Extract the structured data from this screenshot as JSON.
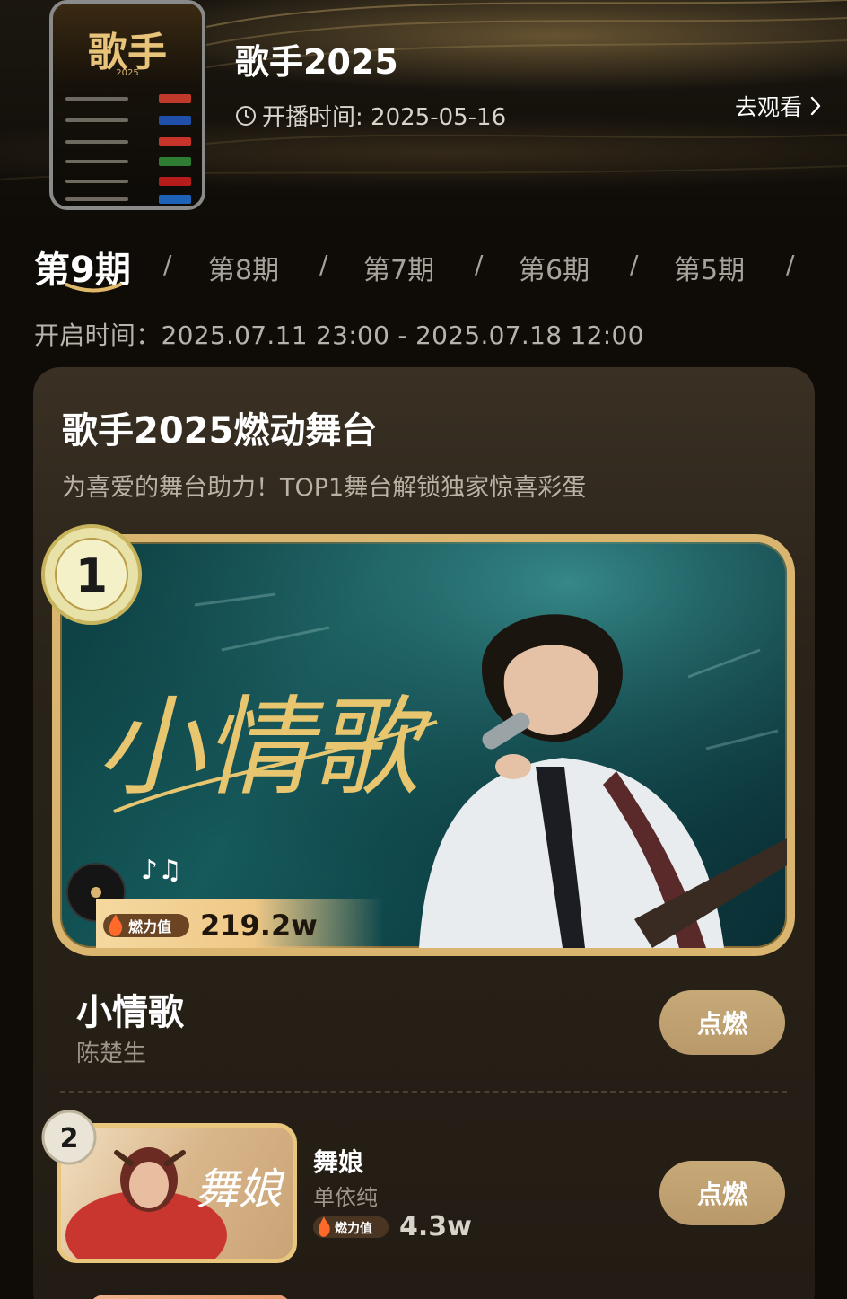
{
  "header": {
    "show_title": "歌手2025",
    "air_label": "开播时间: 2025-05-16",
    "watch_label": "去观看",
    "poster_title": "歌手",
    "poster_year": "2025"
  },
  "episodes": {
    "tabs": [
      "第9期",
      "第8期",
      "第7期",
      "第6期",
      "第5期"
    ],
    "separator": "/",
    "active_index": 0
  },
  "open_time": "开启时间：2025.07.11 23:00 - 2025.07.18 12:00",
  "board": {
    "title": "歌手2025燃动舞台",
    "subtitle": "为喜爱的舞台助力！TOP1舞台解锁独家惊喜彩蛋",
    "fire_label": "燃力值",
    "ignite_label": "点燃",
    "entries": [
      {
        "rank": "1",
        "art_text": "小情歌",
        "song": "小情歌",
        "artist": "陈楚生",
        "fire_value": "219.2w"
      },
      {
        "rank": "2",
        "art_text": "舞娘",
        "song": "舞娘",
        "artist": "单依纯",
        "fire_value": "4.3w"
      }
    ]
  },
  "colors": {
    "gold": "#d9b56f",
    "button": "#c2a371",
    "card_bg": "#2a2319",
    "page_bg": "#0f0c08"
  }
}
